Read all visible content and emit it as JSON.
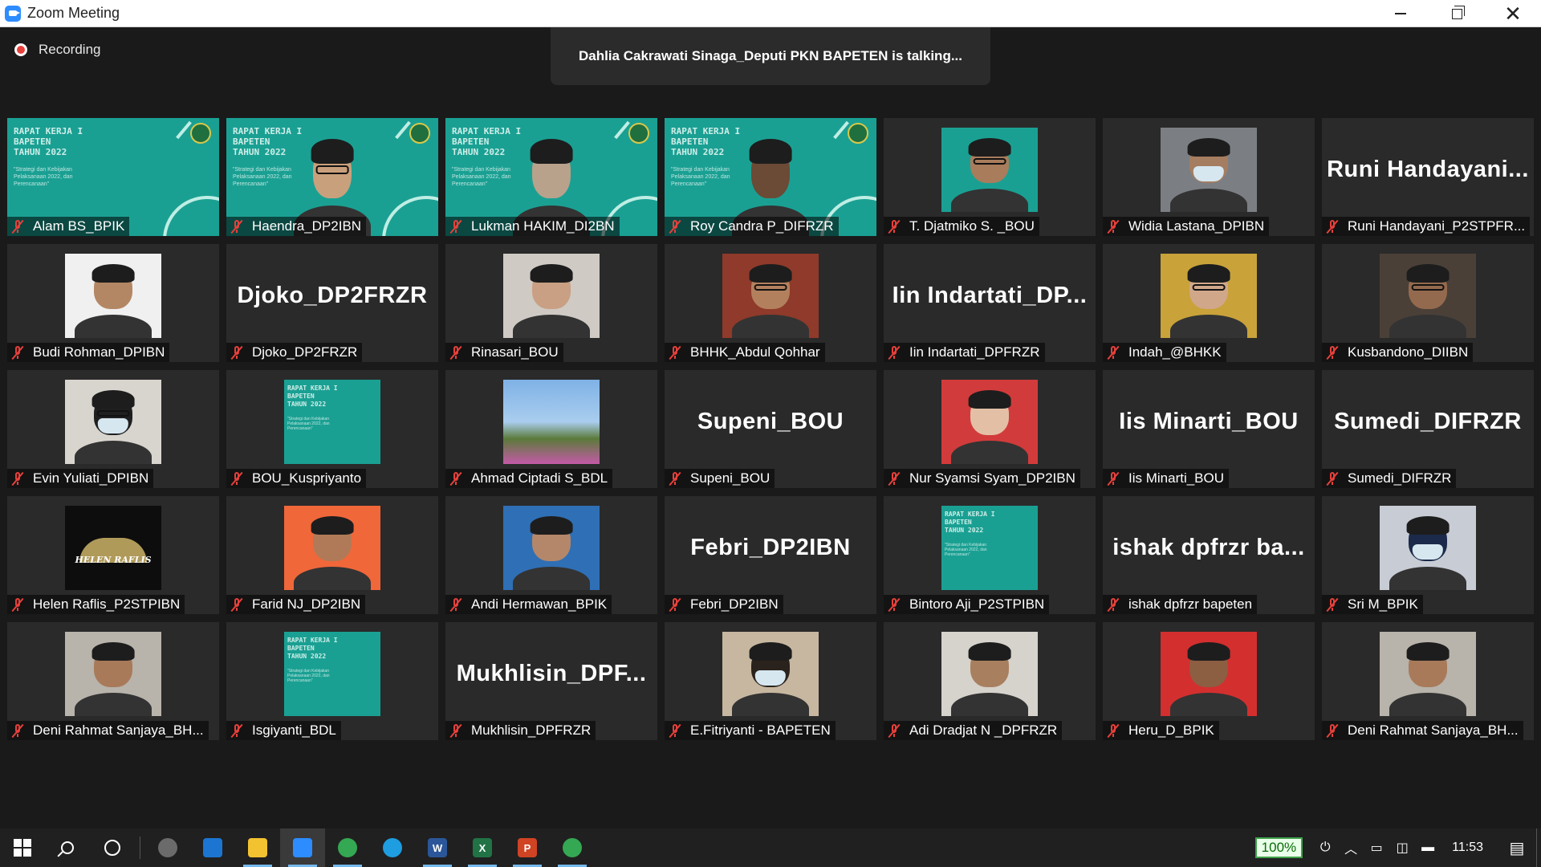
{
  "window": {
    "title": "Zoom Meeting",
    "controls": {
      "minimize": "minimize",
      "restore": "restore",
      "close": "✕"
    }
  },
  "meeting": {
    "recording_label": "Recording",
    "talking_banner": "Dahlia Cakrawati Sinaga_Deputi PKN BAPETEN is talking...",
    "slide_text": {
      "title": "RAPAT KERJA I\nBAPETEN\nTAHUN 2022",
      "subtitle": "\"Strategi dan Kebijakan Pelaksanaan 2022, dan Perencanaan\""
    },
    "participants": [
      {
        "name": "Alam BS_BPIK",
        "kind": "slide"
      },
      {
        "name": "Haendra_DP2IBN",
        "kind": "slide-person",
        "skin": "#c9a07c",
        "glasses": true
      },
      {
        "name": "Lukman HAKIM_DI2BN",
        "kind": "slide-person",
        "skin": "#b8a28c",
        "glasses": false
      },
      {
        "name": "Roy Candra P_DIFRZR",
        "kind": "slide-person",
        "skin": "#6b4a36",
        "glasses": false
      },
      {
        "name": "T. Djatmiko S. _BOU",
        "kind": "photo",
        "bg": "#1aa093",
        "skin": "#a97c5c",
        "glasses": true
      },
      {
        "name": "Widia Lastana_DPIBN",
        "kind": "photo",
        "bg": "#7b7f84",
        "skin": "#a57d60",
        "glasses": false,
        "mask": true
      },
      {
        "name": "Runi Handayani_P2STPFR...",
        "kind": "text",
        "display": "Runi  Handayani..."
      },
      {
        "name": "Budi Rohman_DPIBN",
        "kind": "photo",
        "bg": "#f0f0f0",
        "skin": "#b48764",
        "glasses": false
      },
      {
        "name": "Djoko_DP2FRZR",
        "kind": "text",
        "display": "Djoko_DP2FRZR"
      },
      {
        "name": "Rinasari_BOU",
        "kind": "photo",
        "bg": "#cfcac4",
        "skin": "#c9a083",
        "glasses": false
      },
      {
        "name": "BHHK_Abdul Qohhar",
        "kind": "photo",
        "bg": "#8f3a2a",
        "skin": "#b3805e",
        "glasses": true
      },
      {
        "name": "Iin Indartati_DPFRZR",
        "kind": "text",
        "display": "Iin  Indartati_DP..."
      },
      {
        "name": "Indah_@BHKK",
        "kind": "photo",
        "bg": "#c9a23a",
        "skin": "#d1a78a",
        "glasses": true
      },
      {
        "name": "Kusbandono_DIIBN",
        "kind": "photo",
        "bg": "#4a4038",
        "skin": "#946a4e",
        "glasses": true
      },
      {
        "name": "Evin Yuliati_DPIBN",
        "kind": "photo",
        "bg": "#d8d4ce",
        "skin": "#1f1f1f",
        "glasses": true,
        "mask": true
      },
      {
        "name": "BOU_Kuspriyanto",
        "kind": "slide-small"
      },
      {
        "name": "Ahmad Ciptadi S_BDL",
        "kind": "photo",
        "bg": "#6fa0d8",
        "skin": "#5a7a3c",
        "glasses": false,
        "landscape": true
      },
      {
        "name": "Supeni_BOU",
        "kind": "text",
        "display": "Supeni_BOU"
      },
      {
        "name": "Nur Syamsi Syam_DP2IBN",
        "kind": "photo",
        "bg": "#d23b3b",
        "skin": "#e3c0a5",
        "glasses": false
      },
      {
        "name": "Iis Minarti_BOU",
        "kind": "text",
        "display": "Iis Minarti_BOU"
      },
      {
        "name": "Sumedi_DIFRZR",
        "kind": "text",
        "display": "Sumedi_DIFRZR"
      },
      {
        "name": "Helen Raflis_P2STPIBN",
        "kind": "logo",
        "logo_text": "HELEN RAFLIS"
      },
      {
        "name": "Farid NJ_DP2IBN",
        "kind": "photo",
        "bg": "#f0673a",
        "skin": "#b07a58",
        "glasses": false
      },
      {
        "name": "Andi Hermawan_BPIK",
        "kind": "photo",
        "bg": "#2f6fb5",
        "skin": "#b5876a",
        "glasses": false
      },
      {
        "name": "Febri_DP2IBN",
        "kind": "text",
        "display": "Febri_DP2IBN"
      },
      {
        "name": "Bintoro Aji_P2STPIBN",
        "kind": "slide-small"
      },
      {
        "name": "ishak dpfrzr bapeten",
        "kind": "text",
        "display": "ishak  dpfrzr  ba..."
      },
      {
        "name": "Sri M_BPIK",
        "kind": "photo",
        "bg": "#c8ccd4",
        "skin": "#1b2a4a",
        "glasses": false,
        "mask": true
      },
      {
        "name": "Deni Rahmat Sanjaya_BH...",
        "kind": "photo",
        "bg": "#b8b3ab",
        "skin": "#a87a5a",
        "glasses": false
      },
      {
        "name": "Isgiyanti_BDL",
        "kind": "slide-small"
      },
      {
        "name": "Mukhlisin_DPFRZR",
        "kind": "text",
        "display": "Mukhlisin_DPF..."
      },
      {
        "name": "E.Fitriyanti - BAPETEN",
        "kind": "photo",
        "bg": "#c7b7a0",
        "skin": "#2a221c",
        "glasses": false,
        "mask": true
      },
      {
        "name": "Adi Dradjat N _DPFRZR",
        "kind": "photo",
        "bg": "#d6d2cc",
        "skin": "#a8805f",
        "glasses": false
      },
      {
        "name": "Heru_D_BPIK",
        "kind": "photo",
        "bg": "#d32f2f",
        "skin": "#8c5e42",
        "glasses": false
      },
      {
        "name": "Deni Rahmat Sanjaya_BH...",
        "kind": "photo",
        "bg": "#b8b3ab",
        "skin": "#a87a5a",
        "glasses": false
      }
    ]
  },
  "taskbar": {
    "apps": [
      {
        "name": "start-button",
        "icon": "windows-logo"
      },
      {
        "name": "search-button",
        "icon": "search-icon"
      },
      {
        "name": "cortana-button",
        "icon": "circle-icon"
      },
      {
        "name": "app-paint",
        "icon": "palette-icon",
        "color": "#6b6b6b"
      },
      {
        "name": "app-mail",
        "icon": "mail-icon",
        "color": "#1c75d1"
      },
      {
        "name": "app-explorer",
        "icon": "folder-icon",
        "color": "#f2c230"
      },
      {
        "name": "app-zoom",
        "icon": "zoom-icon",
        "color": "#2d8cff"
      },
      {
        "name": "app-chrome",
        "icon": "chrome-icon",
        "color": "#34a853"
      },
      {
        "name": "app-edge",
        "icon": "edge-icon",
        "color": "#1e9de0"
      },
      {
        "name": "app-word",
        "icon": "word-icon",
        "color": "#2b579a",
        "glyph": "W"
      },
      {
        "name": "app-excel",
        "icon": "excel-icon",
        "color": "#217346",
        "glyph": "X"
      },
      {
        "name": "app-powerpoint",
        "icon": "powerpoint-icon",
        "color": "#d04423",
        "glyph": "P"
      },
      {
        "name": "app-chrome-2",
        "icon": "chrome-icon",
        "color": "#34a853"
      }
    ],
    "zoom_level": "100%",
    "clock": "11:53"
  }
}
